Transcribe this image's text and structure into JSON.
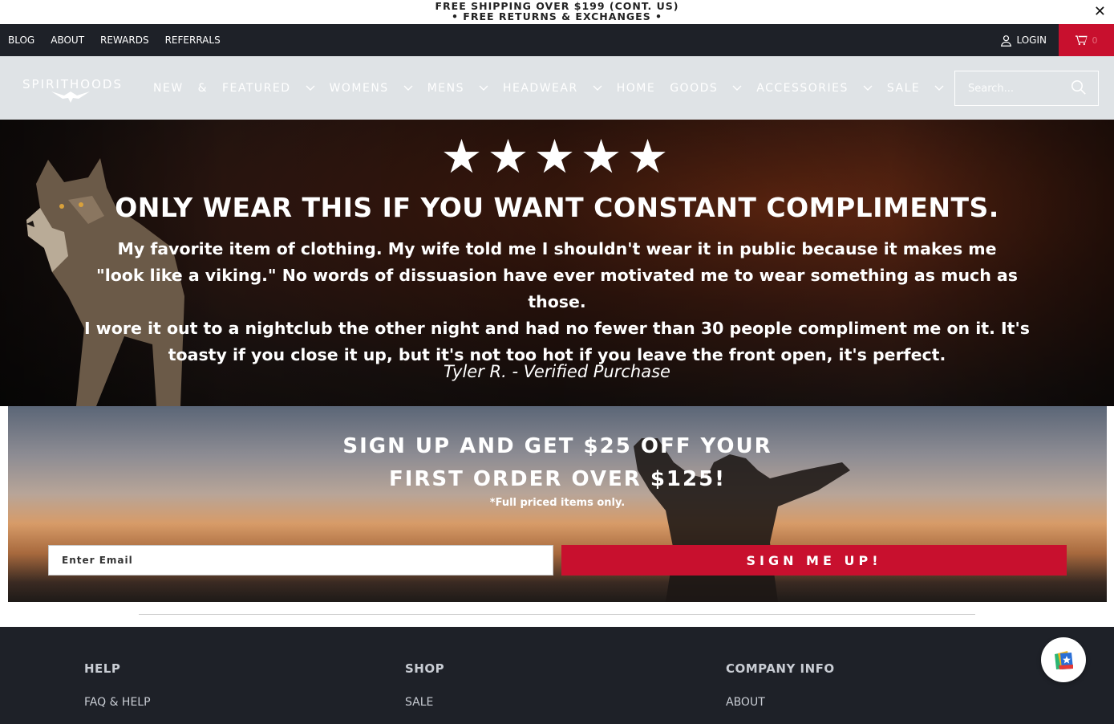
{
  "announcement": {
    "line1": "FREE SHIPPING OVER $199 (CONT. US)",
    "line2": "• FREE RETURNS & EXCHANGES •",
    "close": "✕"
  },
  "topbar": {
    "links": [
      "BLOG",
      "ABOUT",
      "REWARDS",
      "REFERRALS"
    ],
    "login": "LOGIN",
    "cart_count": "0"
  },
  "header": {
    "logo": "SPIRITHOODS",
    "nav": [
      {
        "label": "NEW & FEATURED",
        "has_dropdown": true
      },
      {
        "label": "WOMENS",
        "has_dropdown": true
      },
      {
        "label": "MENS",
        "has_dropdown": true
      },
      {
        "label": "HEADWEAR",
        "has_dropdown": true
      },
      {
        "label": "HOME",
        "has_dropdown": false
      },
      {
        "label": "GOODS",
        "has_dropdown": true
      },
      {
        "label": "ACCESSORIES",
        "has_dropdown": true
      },
      {
        "label": "SALE",
        "has_dropdown": true
      }
    ],
    "search_placeholder": "Search..."
  },
  "hero": {
    "stars": "★★★★★",
    "rating": 5,
    "headline": "ONLY WEAR THIS IF YOU WANT CONSTANT COMPLIMENTS.",
    "quote_lines": [
      "My favorite item of clothing. My wife told me I shouldn't wear it in public because it makes me",
      "\"look like a viking.\" No words of dissuasion have ever motivated me to wear something as much as those.",
      "I wore it out to a nightclub the other night and had no fewer than 30 people compliment me on it. It's",
      "toasty if you close it up, but it's not too hot if you leave the front open, it's perfect."
    ],
    "author": "Tyler R. - Verified Purchase"
  },
  "newsletter": {
    "title_line1": "SIGN UP AND GET $25 OFF YOUR",
    "title_line2": "FIRST ORDER OVER $125!",
    "note": "*Full priced items only.",
    "email_placeholder": "Enter Email",
    "button": "SIGN ME UP!"
  },
  "footer": {
    "columns": [
      {
        "title": "HELP",
        "first_link": "FAQ & HELP"
      },
      {
        "title": "SHOP",
        "first_link": "SALE"
      },
      {
        "title": "COMPANY INFO",
        "first_link": "ABOUT"
      }
    ]
  },
  "colors": {
    "accent": "#c8102e",
    "dark": "#1e2128",
    "header_bg": "#dfe3e6"
  }
}
